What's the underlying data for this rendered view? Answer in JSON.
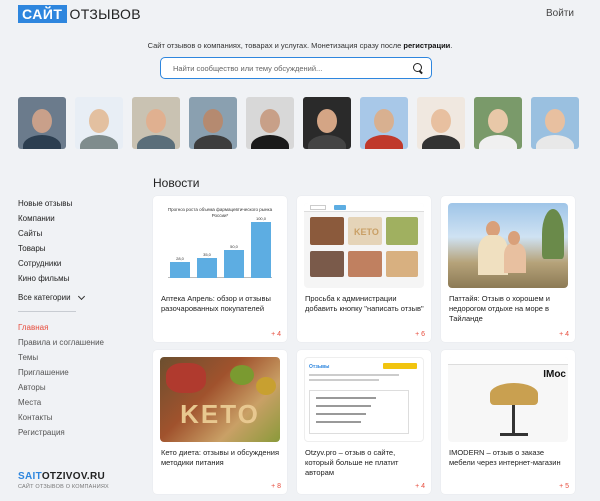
{
  "header": {
    "logo_box": "САЙТ",
    "logo_text": "ОТЗЫВОВ",
    "login": "Войти",
    "tagline_pre": "Сайт отзывов о компаниях, товарах и услугах. Монетизация сразу после ",
    "tagline_link": "регистрации",
    "tagline_post": ".",
    "search_placeholder": "Найти сообщество или тему обсуждений...",
    "colors": {
      "brand": "#2e86de",
      "accent": "#e74c3c"
    }
  },
  "avatars": [
    {
      "bg": "#6b7b8c",
      "skin": "#c9a08a",
      "cloth": "#2c3e50"
    },
    {
      "bg": "#e8eef5",
      "skin": "#e3c0a0",
      "cloth": "#7f8c8d"
    },
    {
      "bg": "#c9c2b2",
      "skin": "#e0b090",
      "cloth": "#5a6e7a"
    },
    {
      "bg": "#8aa0b0",
      "skin": "#b58a70",
      "cloth": "#3d3d3d"
    },
    {
      "bg": "#d8d8d8",
      "skin": "#c8a088",
      "cloth": "#1a1a1a"
    },
    {
      "bg": "#2a2a2a",
      "skin": "#d4a585",
      "cloth": "#444"
    },
    {
      "bg": "#a8c8e8",
      "skin": "#d8b090",
      "cloth": "#c0392b"
    },
    {
      "bg": "#f0e8e0",
      "skin": "#e8c0a0",
      "cloth": "#333"
    },
    {
      "bg": "#7a9a6a",
      "skin": "#e8c8a8",
      "cloth": "#f0f0f0"
    },
    {
      "bg": "#9ac0e0",
      "skin": "#e8c0a0",
      "cloth": "#e8e8e8"
    }
  ],
  "sidebar": {
    "top": [
      "Новые отзывы",
      "Компании",
      "Сайты",
      "Товары",
      "Сотрудники",
      "Кино фильмы"
    ],
    "all_categories": "Все категории",
    "bottom": [
      "Главная",
      "Правила и соглашение",
      "Темы",
      "Приглашение",
      "Авторы",
      "Места",
      "Контакты",
      "Регистрация"
    ]
  },
  "footer": {
    "logo_main_accent": "SAIT",
    "logo_main": "OTZIVOV.RU",
    "logo_sub": "САЙТ ОТЗЫВОВ О КОМПАНИЯХ"
  },
  "news": {
    "title": "Новости",
    "cards": [
      {
        "title": "Аптека Апрель: обзор и отзывы разочарованных покупателей",
        "count": "+ 4"
      },
      {
        "title": "Просьба к администрации добавить кнопку \"написать отзыв\"",
        "count": "+ 6"
      },
      {
        "title": "Паттайя: Отзыв о хорошем и недорогом отдыхе на море в Тайланде",
        "count": "+ 4"
      },
      {
        "title": "Кето диета: отзывы и обсуждения методики питания",
        "count": "+ 8"
      },
      {
        "title": "Otzyv.pro – отзыв о сайте, который больше не платит авторам",
        "count": "+ 4"
      },
      {
        "title": "IMODERN – отзыв о заказе мебели через интернет-магазин",
        "count": "+ 5"
      }
    ],
    "chart_thumb": {
      "title": "Прогноз роста объема фармацевтического рынка России*",
      "values": [
        "28,0",
        "35,0",
        "50,0",
        "100,0"
      ],
      "heights": [
        28,
        35,
        50,
        100
      ]
    },
    "keto_word": "KETO",
    "otzyv_brand": "Отзывы",
    "imodern_brand": "IMoc"
  }
}
